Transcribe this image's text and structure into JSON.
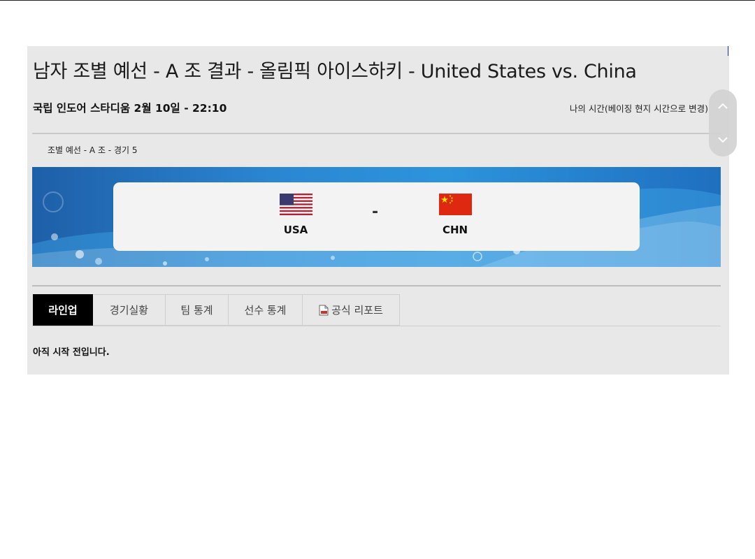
{
  "page": {
    "title": "남자 조별 예선 - A 조 결과 - 올림픽 아이스하키 - United States vs. China",
    "venue_line": "국립 인도어 스타디움 2월 10일 - 22:10",
    "time_toggle": "나의 시간(베이징 현지 시간으로 변경)"
  },
  "breadcrumb": "조별 예선 - A 조 - 경기 5",
  "match": {
    "home": {
      "code": "USA",
      "flag": "us-flag-icon"
    },
    "away": {
      "code": "CHN",
      "flag": "cn-flag-icon"
    },
    "separator": "-"
  },
  "tabs": [
    {
      "label": "라인업",
      "active": true
    },
    {
      "label": "경기실황",
      "active": false
    },
    {
      "label": "팀 통계",
      "active": false
    },
    {
      "label": "선수 통계",
      "active": false
    },
    {
      "label": "공식 리포트",
      "active": false,
      "icon": "pdf-icon"
    }
  ],
  "status_message": "아직 시작 전입니다.",
  "colors": {
    "banner_blue": "#2b86d2",
    "active_tab": "#000000",
    "panel_bg": "#e8e8e8"
  }
}
